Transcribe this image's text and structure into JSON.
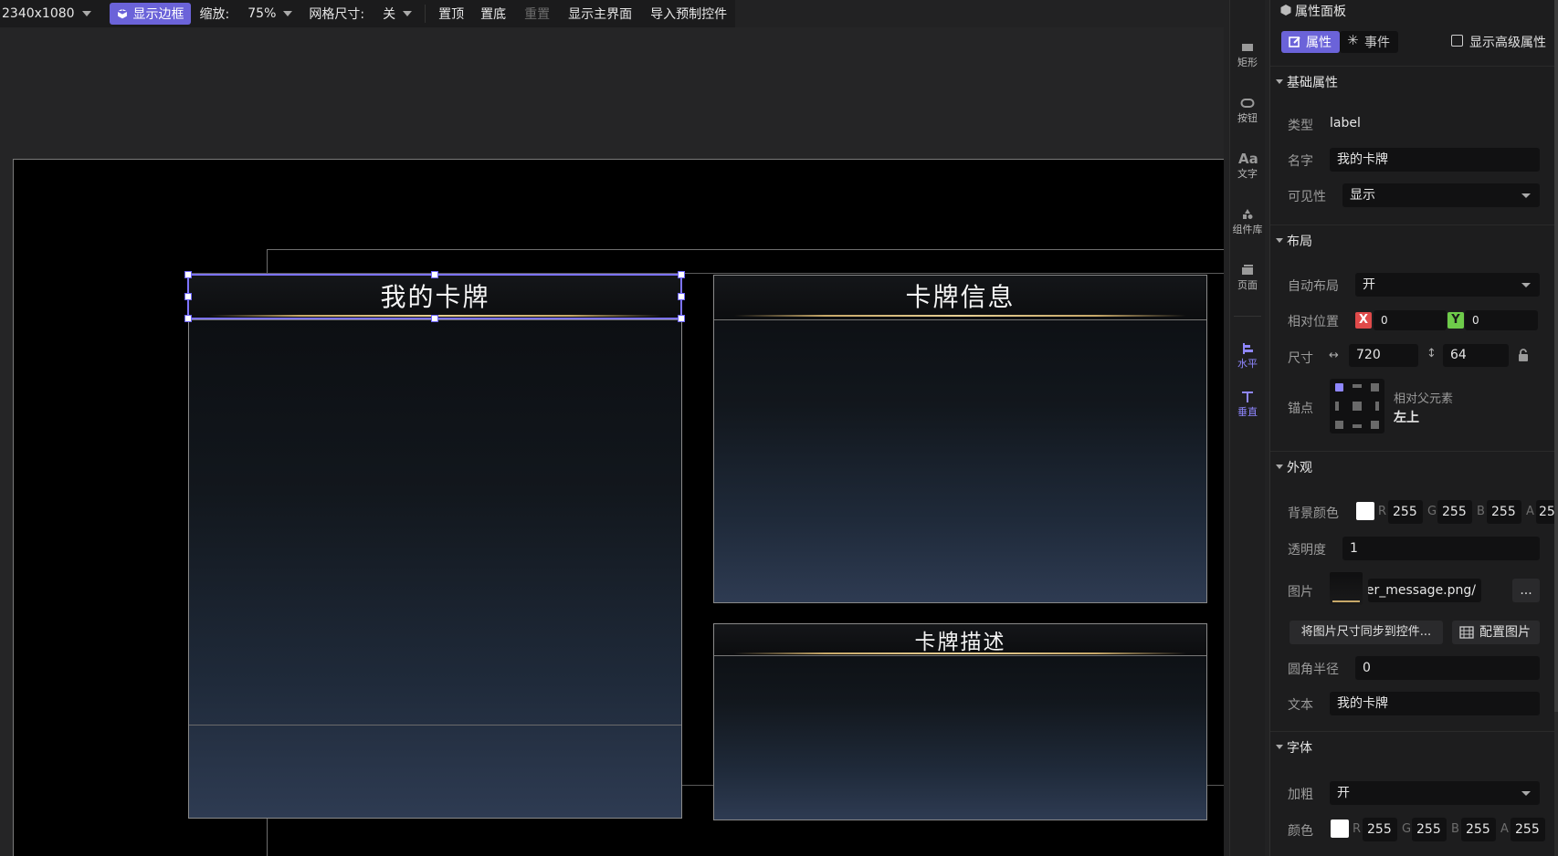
{
  "toolbar": {
    "resolution": "2340x1080",
    "show_border": "显示边框",
    "zoom_label": "缩放:",
    "zoom_value": "75%",
    "grid_label": "网格尺寸:",
    "grid_value": "关",
    "bring_top": "置顶",
    "send_bottom": "置底",
    "reset": "重置",
    "show_main_ui": "显示主界面",
    "import_prefab": "导入预制控件"
  },
  "canvas": {
    "panels": [
      {
        "title": "我的卡牌"
      },
      {
        "title": "卡牌信息"
      },
      {
        "title": "卡牌描述"
      }
    ]
  },
  "tools": [
    {
      "label": "矩形",
      "icon": "rectangle-icon"
    },
    {
      "label": "按钮",
      "icon": "button-icon"
    },
    {
      "label": "文字",
      "icon": "text-icon"
    },
    {
      "label": "组件库",
      "icon": "component-library-icon"
    },
    {
      "label": "页面",
      "icon": "page-icon"
    },
    {
      "label": "水平",
      "icon": "align-horizontal-icon"
    },
    {
      "label": "垂直",
      "icon": "align-vertical-icon"
    }
  ],
  "props": {
    "title": "属性面板",
    "tab_props": "属性",
    "tab_events": "事件",
    "show_advanced": "显示高级属性",
    "basic": {
      "title": "基础属性",
      "type_label": "类型",
      "type_value": "label",
      "name_label": "名字",
      "name_value": "我的卡牌",
      "visibility_label": "可见性",
      "visibility_value": "显示"
    },
    "layout": {
      "title": "布局",
      "auto_layout_label": "自动布局",
      "auto_layout_value": "开",
      "rel_pos_label": "相对位置",
      "x_tag": "X",
      "x_value": "0",
      "y_tag": "Y",
      "y_value": "0",
      "size_label": "尺寸",
      "width": "720",
      "height": "64",
      "anchor_label": "锚点",
      "anchor_relative": "相对父元素",
      "anchor_value": "左上"
    },
    "appearance": {
      "title": "外观",
      "bg_color_label": "背景颜色",
      "r": "255",
      "g": "255",
      "b": "255",
      "a": "25",
      "opacity_label": "透明度",
      "opacity_value": "1",
      "image_label": "图片",
      "image_value": "/timer_message.png",
      "image_more": "...",
      "sync_size_btn": "将图片尺寸同步到控件...",
      "config_image_btn": "配置图片",
      "radius_label": "圆角半径",
      "radius_value": "0",
      "text_label": "文本",
      "text_value": "我的卡牌"
    },
    "font": {
      "title": "字体",
      "bold_label": "加粗",
      "bold_value": "开",
      "color_label": "颜色",
      "r": "255",
      "g": "255",
      "b": "255",
      "a": "255"
    },
    "channel_labels": {
      "r": "R",
      "g": "G",
      "b": "B",
      "a": "A"
    }
  }
}
